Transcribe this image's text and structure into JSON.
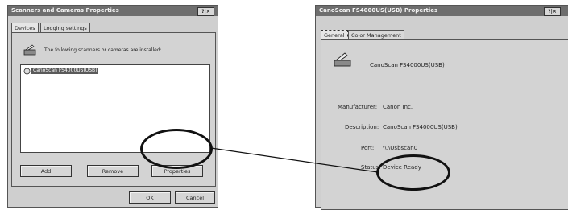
{
  "left_dialog": {
    "title": "Scanners and Cameras Properties",
    "close_glyph": "?|×",
    "tabs": [
      "Devices",
      "Logging settings"
    ],
    "info_text": "The following scanners or cameras are installed:",
    "device_item": "CanoScan FS4000US(USB)",
    "buttons": {
      "add": "Add",
      "remove": "Remove",
      "properties": "Properties"
    },
    "ok": "OK",
    "cancel": "Cancel"
  },
  "right_dialog": {
    "title": "CanoScan FS4000US(USB) Properties",
    "close_glyph": "?|×",
    "tabs": [
      "General",
      "Color Management"
    ],
    "device_name": "CanoScan FS4000US(USB)",
    "fields": [
      {
        "label": "Manufacturer:",
        "value": "Canon Inc."
      },
      {
        "label": "Description:",
        "value": "CanoScan FS4000US(USB)"
      },
      {
        "label": "Port:",
        "value": "\\\\.\\Usbscan0"
      },
      {
        "label": "Status:",
        "value": "Device Ready"
      }
    ]
  }
}
